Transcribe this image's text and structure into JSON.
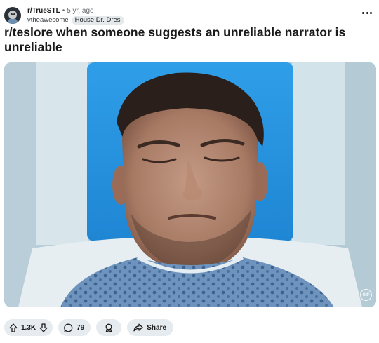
{
  "post": {
    "subreddit": "r/TrueSTL",
    "separator": "•",
    "age": "5 yr. ago",
    "author": "vtheawesome",
    "flair": "House Dr. Dres",
    "title": "r/teslore when someone suggests an unreliable narrator is unreliable",
    "media_badge": "GIF"
  },
  "actions": {
    "vote_count": "1.3K",
    "comment_count": "79",
    "share_label": "Share"
  },
  "icons": {
    "subreddit_avatar": "subreddit-avatar",
    "more": "more-options-icon",
    "upvote": "upvote-arrow-icon",
    "downvote": "downvote-arrow-icon",
    "comment": "comment-bubble-icon",
    "award": "award-icon",
    "share": "share-arrow-icon"
  },
  "colors": {
    "pill_background": "#e5ebee",
    "text": "#1a1a1b",
    "muted_text": "#6a6d70",
    "flair_background": "#e4e9ec"
  }
}
